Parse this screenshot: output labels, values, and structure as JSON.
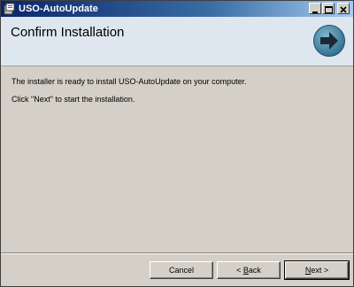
{
  "window": {
    "title": "USO-AutoUpdate"
  },
  "header": {
    "title": "Confirm Installation",
    "icon": "next-arrow-icon"
  },
  "body": {
    "line1": "The installer is ready to install USO-AutoUpdate on your computer.",
    "line2": "Click \"Next\" to start the installation."
  },
  "buttons": {
    "cancel": "Cancel",
    "back_prefix": "< ",
    "back_accel": "B",
    "back_rest": "ack",
    "next_accel": "N",
    "next_rest": "ext >"
  },
  "colors": {
    "titlebar_start": "#0a246a",
    "header_bg": "#dee6ef",
    "face": "#d4d0c8",
    "arrow": "#3a7a9a"
  }
}
